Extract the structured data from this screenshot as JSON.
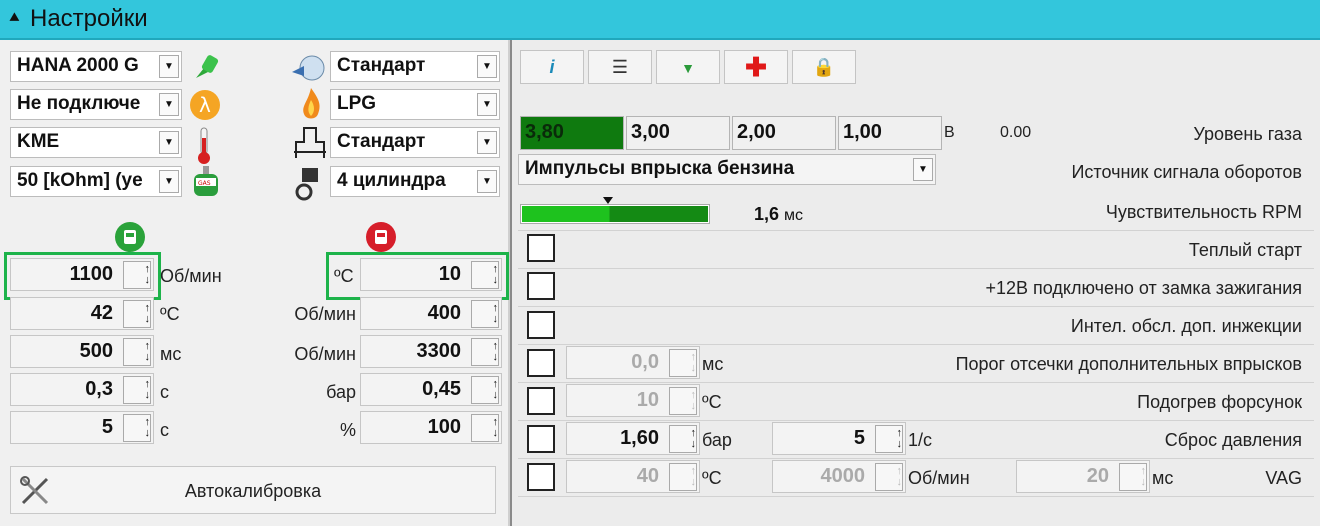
{
  "window": {
    "title": "Настройки"
  },
  "left": {
    "combos_left": [
      "HANA 2000 G",
      "Не подключе",
      "KME",
      "50 [kOhm] (ye"
    ],
    "combos_right": [
      "Стандарт",
      "LPG",
      "Стандарт",
      "4 цилиндра"
    ],
    "col1": {
      "values": [
        "1100",
        "42",
        "500",
        "0,3",
        "5"
      ],
      "units": [
        "Об/мин",
        "ºC",
        "мс",
        "с",
        "с"
      ]
    },
    "col2": {
      "values": [
        "10",
        "400",
        "3300",
        "0,45",
        "100"
      ],
      "units": [
        "ºC",
        "Об/мин",
        "Об/мин",
        "бар",
        "%"
      ]
    },
    "autocal_label": "Автокалибровка",
    "icons": {
      "gas_tank_green": "gas-tank-icon",
      "gas_tank_red": "petrol-icon",
      "lambda": "lambda-icon",
      "flame": "flame-icon",
      "thermometer": "thermometer-icon",
      "injector": "injector-icon"
    }
  },
  "right": {
    "toolbar": [
      "info",
      "list",
      "plug",
      "plus",
      "lock"
    ],
    "gas_levels": [
      "3,80",
      "3,00",
      "2,00",
      "1,00"
    ],
    "gas_unit": "В",
    "gas_value": "0.00",
    "gas_label": "Уровень газа",
    "rpm_source": "Импульсы впрыска бензина",
    "rpm_source_label": "Источник сигнала оборотов",
    "sensitivity_value": "1,6",
    "sensitivity_unit": "мс",
    "sensitivity_label": "Чувствительность RPM",
    "sensitivity_level": 0.47,
    "checks": [
      {
        "label": "Теплый старт"
      },
      {
        "label": "+12В подключено от замка зажигания"
      },
      {
        "label": "Интел. обсл. доп. инжекции"
      },
      {
        "label": "Порог отсечки дополнительных впрысков",
        "value": "0,0",
        "unit": "мс"
      },
      {
        "label": "Подогрев форсунок",
        "value": "10",
        "unit": "ºC"
      },
      {
        "label": "Сброс давления",
        "value": "1,60",
        "unit": "бар",
        "value2": "5",
        "unit2": "1/с"
      },
      {
        "label": "VAG",
        "value": "40",
        "unit": "ºC",
        "value2": "4000",
        "unit2": "Об/мин",
        "value3": "20",
        "unit3": "мс"
      }
    ],
    "colors": {
      "gas_active": "#0f7a0f",
      "progress": "#1ec21e"
    }
  }
}
